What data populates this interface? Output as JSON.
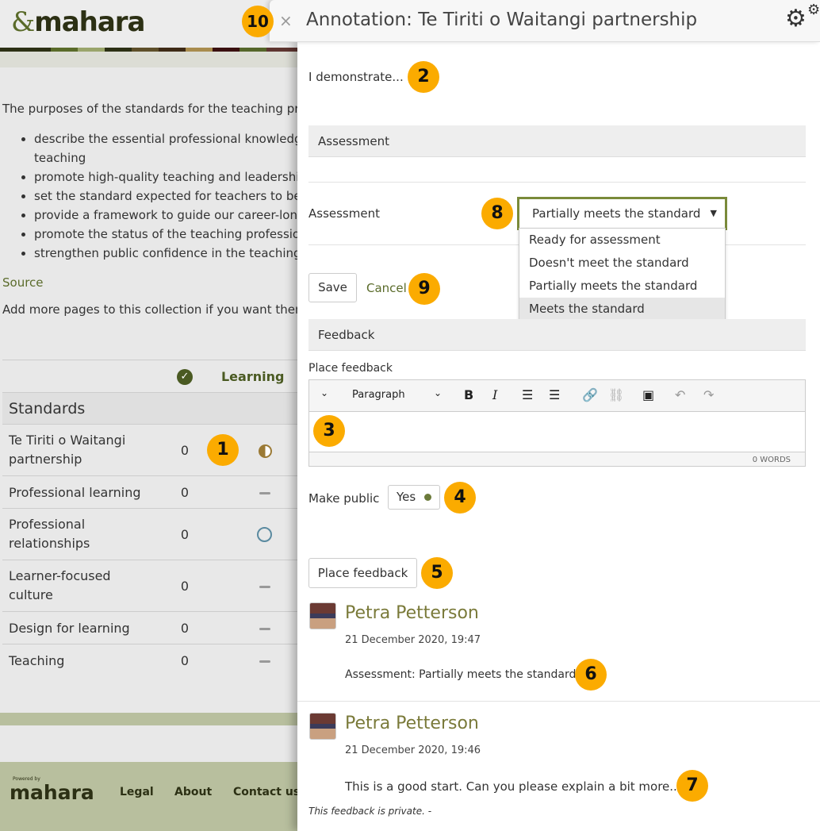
{
  "header": {
    "logo": "mahara"
  },
  "page": {
    "intro": "The purposes of the standards for the teaching pr",
    "bullets": [
      "describe the essential professional knowledg",
      "teaching",
      "promote high-quality teaching and leadershi",
      "set the standard expected for teachers to be",
      "provide a framework to guide our career-long",
      "promote the status of the teaching professio",
      "strengthen public confidence in the teaching"
    ],
    "source_link": "Source",
    "add_more": "Add more pages to this collection if you want then"
  },
  "matrix": {
    "col_check_icon": "check-circle-icon",
    "col_learning": "Learning",
    "category": "Standards",
    "rows": [
      {
        "label": "Te Tiriti o Waitangi partnership",
        "count": "0",
        "status": "partially-meets"
      },
      {
        "label": "Professional learning",
        "count": "0",
        "status": "none"
      },
      {
        "label": "Professional relationships",
        "count": "0",
        "status": "ready"
      },
      {
        "label": "Learner-focused culture",
        "count": "0",
        "status": "none"
      },
      {
        "label": "Design for learning",
        "count": "0",
        "status": "none"
      },
      {
        "label": "Teaching",
        "count": "0",
        "status": "none"
      }
    ]
  },
  "footer": {
    "powered_by": "Powered by",
    "logo": "mahara",
    "links": [
      "Legal",
      "About",
      "Contact us"
    ]
  },
  "modal": {
    "close": "×",
    "title": "Annotation: Te Tiriti o Waitangi partnership",
    "statement": "I demonstrate...",
    "assessment_section": "Assessment",
    "assessment_label": "Assessment",
    "assessment_value": "Partially meets the standard",
    "assessment_options": [
      "Ready for assessment",
      "Doesn't meet the standard",
      "Partially meets the standard",
      "Meets the standard"
    ],
    "save": "Save",
    "cancel": "Cancel",
    "feedback_section": "Feedback",
    "place_feedback_label": "Place feedback",
    "editor": {
      "block_format": "Paragraph",
      "word_count": "0 WORDS"
    },
    "make_public_label": "Make public",
    "make_public_value": "Yes",
    "place_feedback_button": "Place feedback",
    "feedback": [
      {
        "author": "Petra Petterson",
        "date": "21 December 2020, 19:47",
        "text": "Assessment: Partially meets the standard"
      },
      {
        "author": "Petra Petterson",
        "date": "21 December 2020, 19:46",
        "text": "This is a good start. Can you please explain a bit more...",
        "note": "This feedback is private. -"
      }
    ]
  },
  "callouts": [
    "1",
    "2",
    "3",
    "4",
    "5",
    "6",
    "7",
    "8",
    "9",
    "10"
  ],
  "colors": {
    "accent": "#5a6b2a",
    "callout": "#fbab00",
    "partial": "#9b7a35"
  }
}
